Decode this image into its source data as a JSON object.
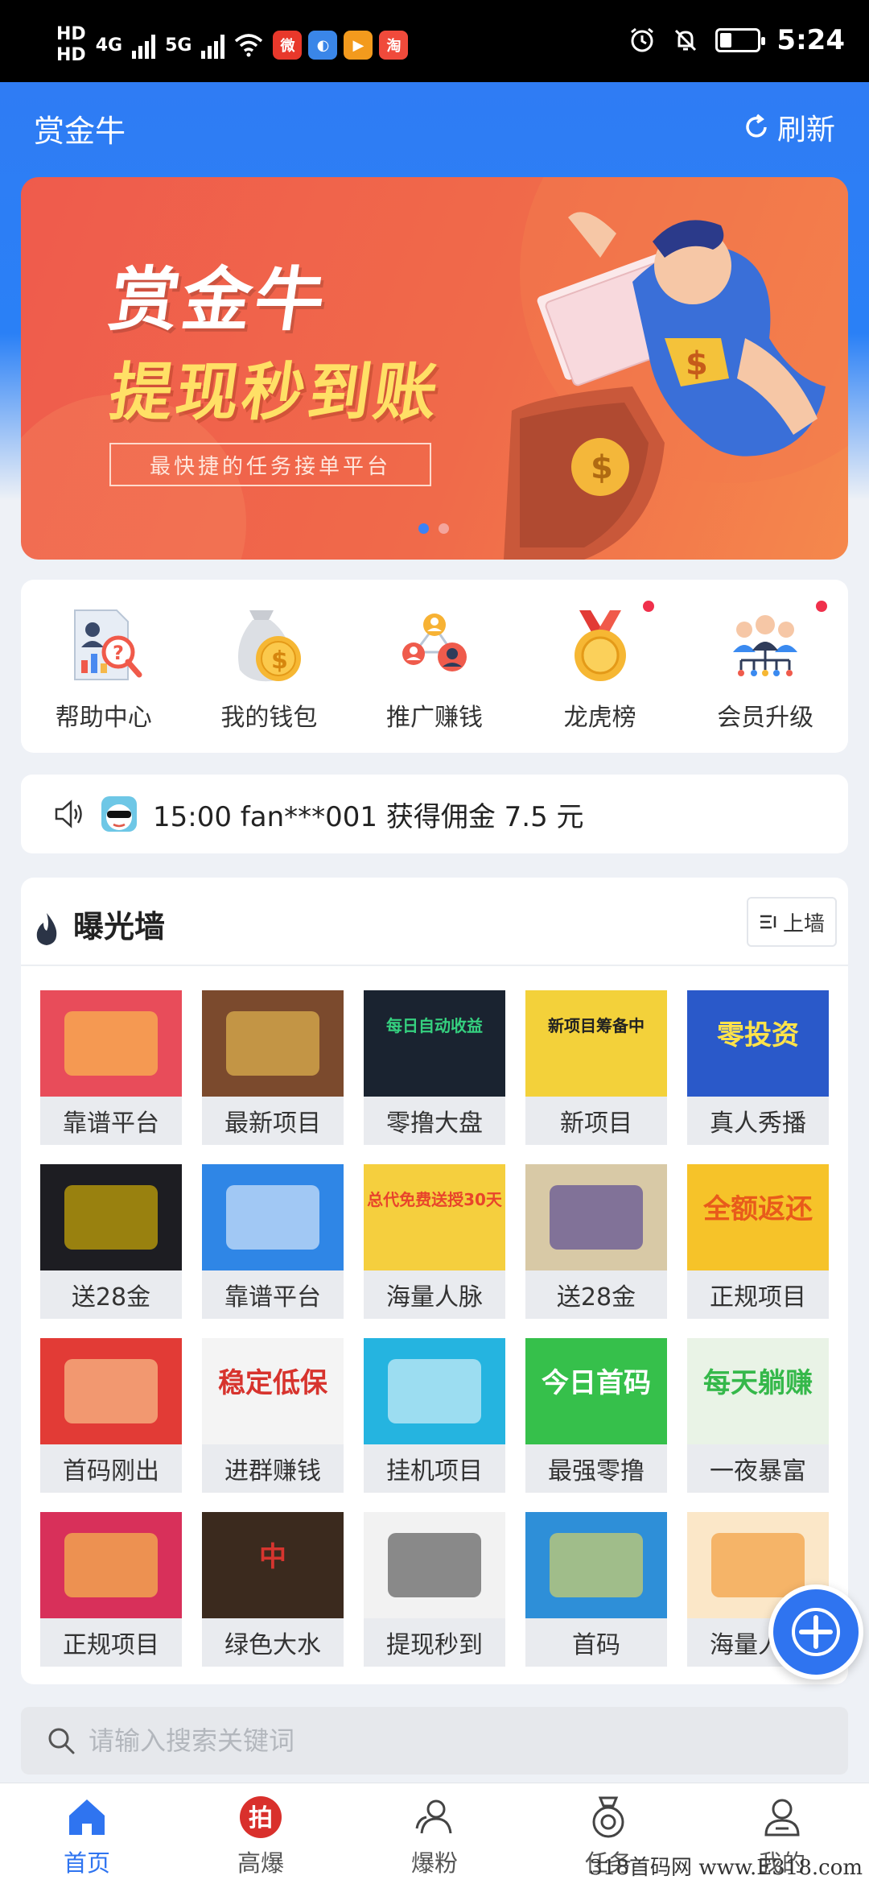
{
  "status_bar": {
    "hd1": "HD",
    "hd2": "HD",
    "net1": "4G",
    "net2": "5G",
    "time": "5:24",
    "app_icons": [
      {
        "name": "weibo-icon",
        "color": "#e8382b",
        "glyph": "微"
      },
      {
        "name": "browser-icon",
        "color": "#3a86e8",
        "glyph": "◐"
      },
      {
        "name": "video-icon",
        "color": "#f39a1d",
        "glyph": "▶"
      },
      {
        "name": "taobao-icon",
        "color": "#f04a3b",
        "glyph": "淘"
      }
    ]
  },
  "header": {
    "title": "赏金牛",
    "refresh_label": "刷新"
  },
  "banner": {
    "title": "赏金牛",
    "headline": "提现秒到账",
    "subtitle": "最快捷的任务接单平台",
    "dots": 2,
    "active_dot": 0
  },
  "quick_menu": [
    {
      "label": "帮助中心",
      "icon": "help-center-icon",
      "dot": false
    },
    {
      "label": "我的钱包",
      "icon": "wallet-icon",
      "dot": false
    },
    {
      "label": "推广赚钱",
      "icon": "promote-icon",
      "dot": false
    },
    {
      "label": "龙虎榜",
      "icon": "medal-icon",
      "dot": true
    },
    {
      "label": "会员升级",
      "icon": "members-icon",
      "dot": true
    }
  ],
  "notice": {
    "text": "15:00 fan***001 获得佣金 7.5 元"
  },
  "wall": {
    "title": "曝光墙",
    "button_label": "上墙",
    "items": [
      {
        "label": "靠谱平台",
        "bg": "#e84c5a",
        "fg": "#ffd84d",
        "text": ""
      },
      {
        "label": "最新项目",
        "bg": "#7b4a2d",
        "fg": "#ffd35a",
        "text": ""
      },
      {
        "label": "零撸大盘",
        "bg": "#1a2330",
        "fg": "#35d07f",
        "text": "每日自动收益"
      },
      {
        "label": "新项目",
        "bg": "#f3d13a",
        "fg": "#222222",
        "text": "新项目筹备中"
      },
      {
        "label": "真人秀播",
        "bg": "#2a59c9",
        "fg": "#ffe34a",
        "text": "零投资"
      },
      {
        "label": "送28金",
        "bg": "#1d1d22",
        "fg": "#ffd400",
        "text": ""
      },
      {
        "label": "靠谱平台",
        "bg": "#2f86e6",
        "fg": "#ffffff",
        "text": ""
      },
      {
        "label": "海量人脉",
        "bg": "#f5cf3e",
        "fg": "#e8442b",
        "text": "总代免费送授30天"
      },
      {
        "label": "送28金",
        "bg": "#d8c9a6",
        "fg": "#3b2a8c",
        "text": ""
      },
      {
        "label": "正规项目",
        "bg": "#f6c329",
        "fg": "#e85b1b",
        "text": "全额返还"
      },
      {
        "label": "首码刚出",
        "bg": "#e23b36",
        "fg": "#ffe6a0",
        "text": ""
      },
      {
        "label": "进群赚钱",
        "bg": "#f4f4f4",
        "fg": "#d7332d",
        "text": "稳定低保"
      },
      {
        "label": "挂机项目",
        "bg": "#25b4e0",
        "fg": "#ffffff",
        "text": ""
      },
      {
        "label": "最强零撸",
        "bg": "#36c04b",
        "fg": "#ffffff",
        "text": "今日首码"
      },
      {
        "label": "一夜暴富",
        "bg": "#e9f3e6",
        "fg": "#35b84a",
        "text": "每天躺赚"
      },
      {
        "label": "正规项目",
        "bg": "#d8305a",
        "fg": "#ffe14a",
        "text": ""
      },
      {
        "label": "绿色大水",
        "bg": "#3b2a1e",
        "fg": "#d6352f",
        "text": "中"
      },
      {
        "label": "提现秒到",
        "bg": "#f2f2f2",
        "fg": "#333333",
        "text": ""
      },
      {
        "label": "首码",
        "bg": "#2e8fd8",
        "fg": "#ffe34a",
        "text": ""
      },
      {
        "label": "海量人脉",
        "bg": "#fbe7c8",
        "fg": "#f08a1a",
        "text": ""
      }
    ]
  },
  "search": {
    "placeholder": "请输入搜索关键词",
    "value": ""
  },
  "tabs": [
    {
      "label": "首页",
      "icon": "home-icon",
      "active": true
    },
    {
      "label": "高爆",
      "icon": "hot-icon",
      "active": false
    },
    {
      "label": "爆粉",
      "icon": "fans-icon",
      "active": false
    },
    {
      "label": "任务",
      "icon": "task-icon",
      "active": false
    },
    {
      "label": "我的",
      "icon": "profile-icon",
      "active": false
    }
  ],
  "watermark": "318首码网 www.E318.com",
  "colors": {
    "primary": "#2f74f0",
    "banner_red": "#ef5b4c"
  }
}
